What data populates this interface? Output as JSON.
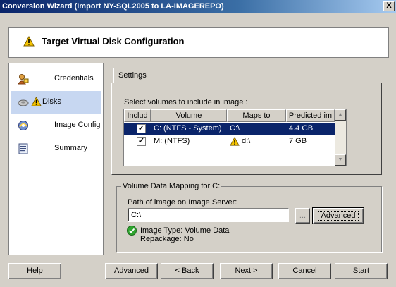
{
  "window": {
    "title": "Conversion Wizard (Import NY-SQL2005 to LA-IMAGEREPO)",
    "close_label": "X"
  },
  "header": {
    "title": "Target Virtual Disk Configuration",
    "icon": "warning-icon"
  },
  "sidebar": {
    "items": [
      {
        "label": "Credentials",
        "icon": "credentials-icon",
        "active": false,
        "warning": false
      },
      {
        "label": "Disks",
        "icon": "disk-icon",
        "active": true,
        "warning": true
      },
      {
        "label": "Image Config",
        "icon": "image-config-icon",
        "active": false,
        "warning": false
      },
      {
        "label": "Summary",
        "icon": "summary-icon",
        "active": false,
        "warning": false
      }
    ]
  },
  "settings": {
    "tab_label": "Settings",
    "select_label": "Select volumes to include in image :",
    "columns": [
      "Includ",
      "Volume",
      "Maps to",
      "Predicted im"
    ],
    "rows": [
      {
        "checked": true,
        "volume": "C: (NTFS - System)",
        "maps_to": "C:\\",
        "predicted": "4.4 GB",
        "selected": true,
        "warning": false
      },
      {
        "checked": true,
        "volume": "M: (NTFS)",
        "maps_to": "d:\\",
        "predicted": "7 GB",
        "selected": false,
        "warning": true
      }
    ]
  },
  "mapping": {
    "legend": "Volume Data Mapping for C:",
    "path_label": "Path of image on Image Server:",
    "path_value": "C:\\",
    "browse_label": "...",
    "advanced_label": "Advanced",
    "status_line1": "Image Type: Volume Data",
    "status_line2": "Repackage: No"
  },
  "footer": {
    "help": {
      "pre": "",
      "u": "H",
      "post": "elp"
    },
    "advanced": {
      "pre": "",
      "u": "A",
      "post": "dvanced"
    },
    "back": {
      "pre": "< ",
      "u": "B",
      "post": "ack"
    },
    "next": {
      "pre": "",
      "u": "N",
      "post": "ext >"
    },
    "cancel": {
      "pre": "",
      "u": "C",
      "post": "ancel"
    },
    "start": {
      "pre": "",
      "u": "S",
      "post": "tart"
    }
  },
  "colors": {
    "title_bar": "#0a246a",
    "selection": "#0a246a",
    "sidebar_active": "#c7d7f1",
    "warning": "#f5c400",
    "ok": "#2fa52f"
  }
}
